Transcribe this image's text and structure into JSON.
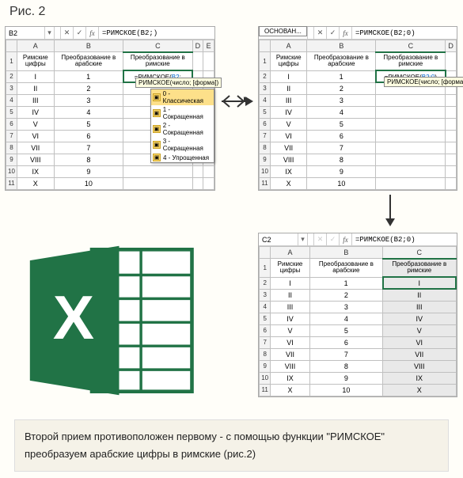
{
  "title": "Рис. 2",
  "panel1": {
    "cellref": "B2",
    "formula": "=РИМСКОЕ(B2;)",
    "cols": [
      "A",
      "B",
      "C",
      "D",
      "E"
    ],
    "headers": [
      "Римские цифры",
      "Преобразование в арабские",
      "Преобразование в римские"
    ],
    "cell_formula_prefix": "=РИМСКОЕ(",
    "cell_formula_ref": "B2",
    "cell_formula_suffix": ";",
    "hint": "РИМСКОЕ(число; [форма])",
    "autocomplete": [
      "0 - Классическая",
      "1 - Сокращенная",
      "2 - Сокращенная",
      "3 - Сокращенная",
      "4 - Упрощенная"
    ],
    "rows": [
      [
        "I",
        "1"
      ],
      [
        "II",
        "2"
      ],
      [
        "III",
        "3"
      ],
      [
        "IV",
        "4"
      ],
      [
        "V",
        "5"
      ],
      [
        "VI",
        "6"
      ],
      [
        "VII",
        "7"
      ],
      [
        "VIII",
        "8"
      ],
      [
        "IX",
        "9"
      ],
      [
        "X",
        "10"
      ]
    ]
  },
  "panel2": {
    "tab": "ОСНОВАН...",
    "formula": "=РИМСКОЕ(B2;0)",
    "cols": [
      "A",
      "B",
      "C",
      "D"
    ],
    "headers": [
      "Римские цифры",
      "Преобразование в арабские",
      "Преобразование в римские"
    ],
    "cell_formula": "=РИМСКОЕ(B2;0)",
    "blue_part": "B2;0",
    "hint": "РИМСКОЕ(число; [форма])",
    "rows": [
      [
        "I",
        "1"
      ],
      [
        "II",
        "2"
      ],
      [
        "III",
        "3"
      ],
      [
        "IV",
        "4"
      ],
      [
        "V",
        "5"
      ],
      [
        "VI",
        "6"
      ],
      [
        "VII",
        "7"
      ],
      [
        "VIII",
        "8"
      ],
      [
        "IX",
        "9"
      ],
      [
        "X",
        "10"
      ]
    ]
  },
  "panel3": {
    "cellref": "C2",
    "formula": "=РИМСКОЕ(B2;0)",
    "cols": [
      "A",
      "B",
      "C"
    ],
    "headers": [
      "Римские цифры",
      "Преобразование в арабские",
      "Преобразование в римские"
    ],
    "rows": [
      [
        "I",
        "1",
        "I"
      ],
      [
        "II",
        "2",
        "II"
      ],
      [
        "III",
        "3",
        "III"
      ],
      [
        "IV",
        "4",
        "IV"
      ],
      [
        "V",
        "5",
        "V"
      ],
      [
        "VI",
        "6",
        "VI"
      ],
      [
        "VII",
        "7",
        "VII"
      ],
      [
        "VIII",
        "8",
        "VIII"
      ],
      [
        "IX",
        "9",
        "IX"
      ],
      [
        "X",
        "10",
        "X"
      ]
    ]
  },
  "caption": "Второй прием противоположен первому - с помощью функции \"РИМСКОЕ\" преобразуем арабские цифры в римские (рис.2)"
}
